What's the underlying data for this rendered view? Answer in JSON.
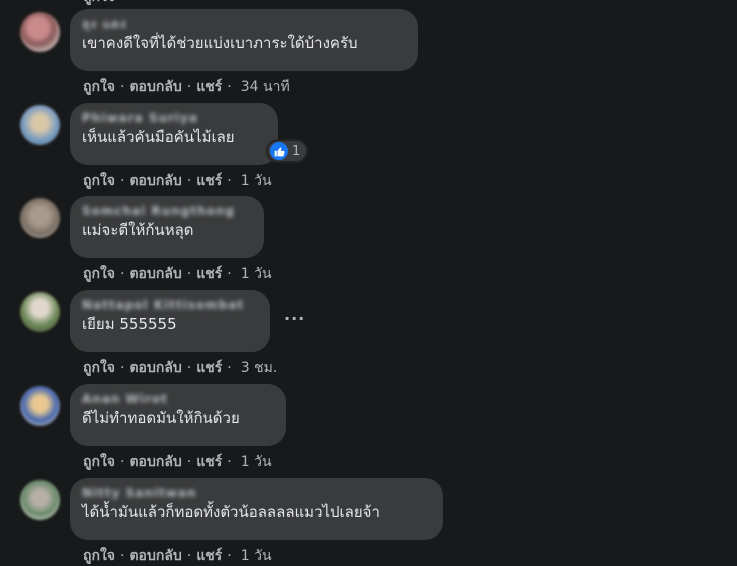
{
  "colors": {
    "background": "#18191a",
    "bubble": "#3a3b3c",
    "comment_text": "#e4e6eb",
    "secondary_text": "#b0b3b8",
    "like_blue": "#1877f2"
  },
  "actions": {
    "like": "ถูกใจ",
    "reply": "ตอบกลับ",
    "share": "แชร์",
    "separator": "·"
  },
  "comments": [
    {
      "author": "ลุง แดง",
      "text": "เขาคงดีใจที่ได้ช่วยแบ่งเบาภาระใด้บ้างครับ",
      "time": "34 นาที"
    },
    {
      "author": "Phiwara Suriya",
      "text": "เห็นแล้วคันมือคันไม้เลย",
      "time": "1 วัน",
      "reaction": {
        "icon": "thumbs-up-icon",
        "count": "1"
      }
    },
    {
      "author": "Somchai Rungthong",
      "text": "แม่จะตีให้ก้นหลุด",
      "time": "1 วัน"
    },
    {
      "author": "Nattapol Kittisombat",
      "text": "เยียม 555555",
      "time": "3 ชม.",
      "menu_icon": "more-horizontal-icon"
    },
    {
      "author": "Anan Wirot",
      "text": "ดีไม่ทำทอดมันให้กินด้วย",
      "time": "1 วัน"
    },
    {
      "author": "Nitty Sanitwan",
      "text": "ได้น้ำมันแล้วก็ทอดทั้งตัวน้อลลลลแมวไปเลยจ้า",
      "time": "1 วัน"
    }
  ]
}
